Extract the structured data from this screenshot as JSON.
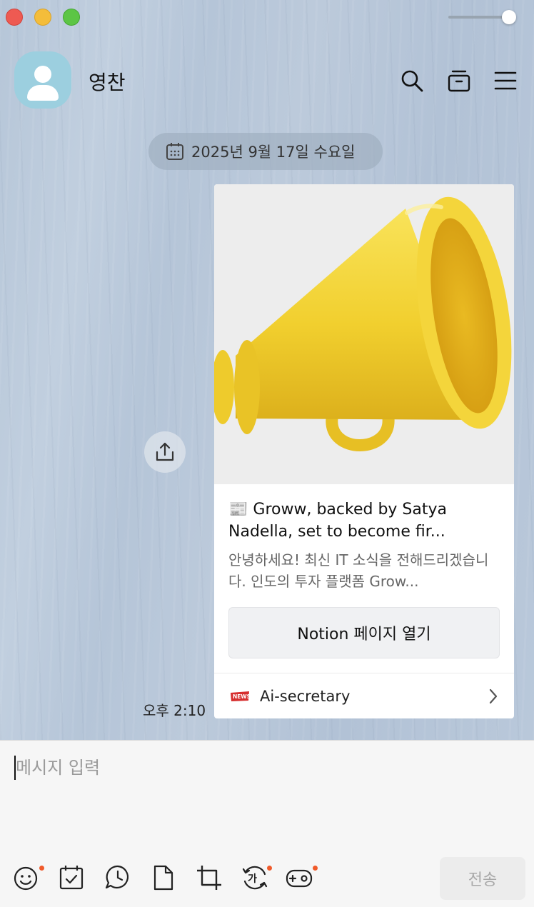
{
  "header": {
    "chat_title": "영찬",
    "icons": [
      "search-icon",
      "archive-icon",
      "menu-icon"
    ]
  },
  "date_divider": {
    "label": "2025년 9월 17일 수요일",
    "icon": "calendar-icon"
  },
  "message": {
    "time": "오후 2:10",
    "share_icon": "share-icon",
    "card": {
      "image": "megaphone-illustration",
      "title_emoji": "📰",
      "title": "Groww, backed by Satya Nadella, set to become fir...",
      "description": "안녕하세요! 최신 IT 소식을 전해드리겠습니다.  인도의 투자 플랫폼 Grow...",
      "button_label": "Notion 페이지 열기",
      "source_name": "Ai-secretary",
      "source_icon": "news-icon"
    }
  },
  "composer": {
    "placeholder": "메시지 입력",
    "value": "",
    "send_label": "전송",
    "tools": [
      "emoticon-icon",
      "calendar-check-icon",
      "clock-chat-icon",
      "file-icon",
      "crop-icon",
      "translate-icon",
      "game-icon"
    ]
  },
  "colors": {
    "chat_background": "#b9c8da",
    "card_background": "#ffffff",
    "notification_dot": "#f05a2a",
    "avatar": "#9ccfdf"
  }
}
